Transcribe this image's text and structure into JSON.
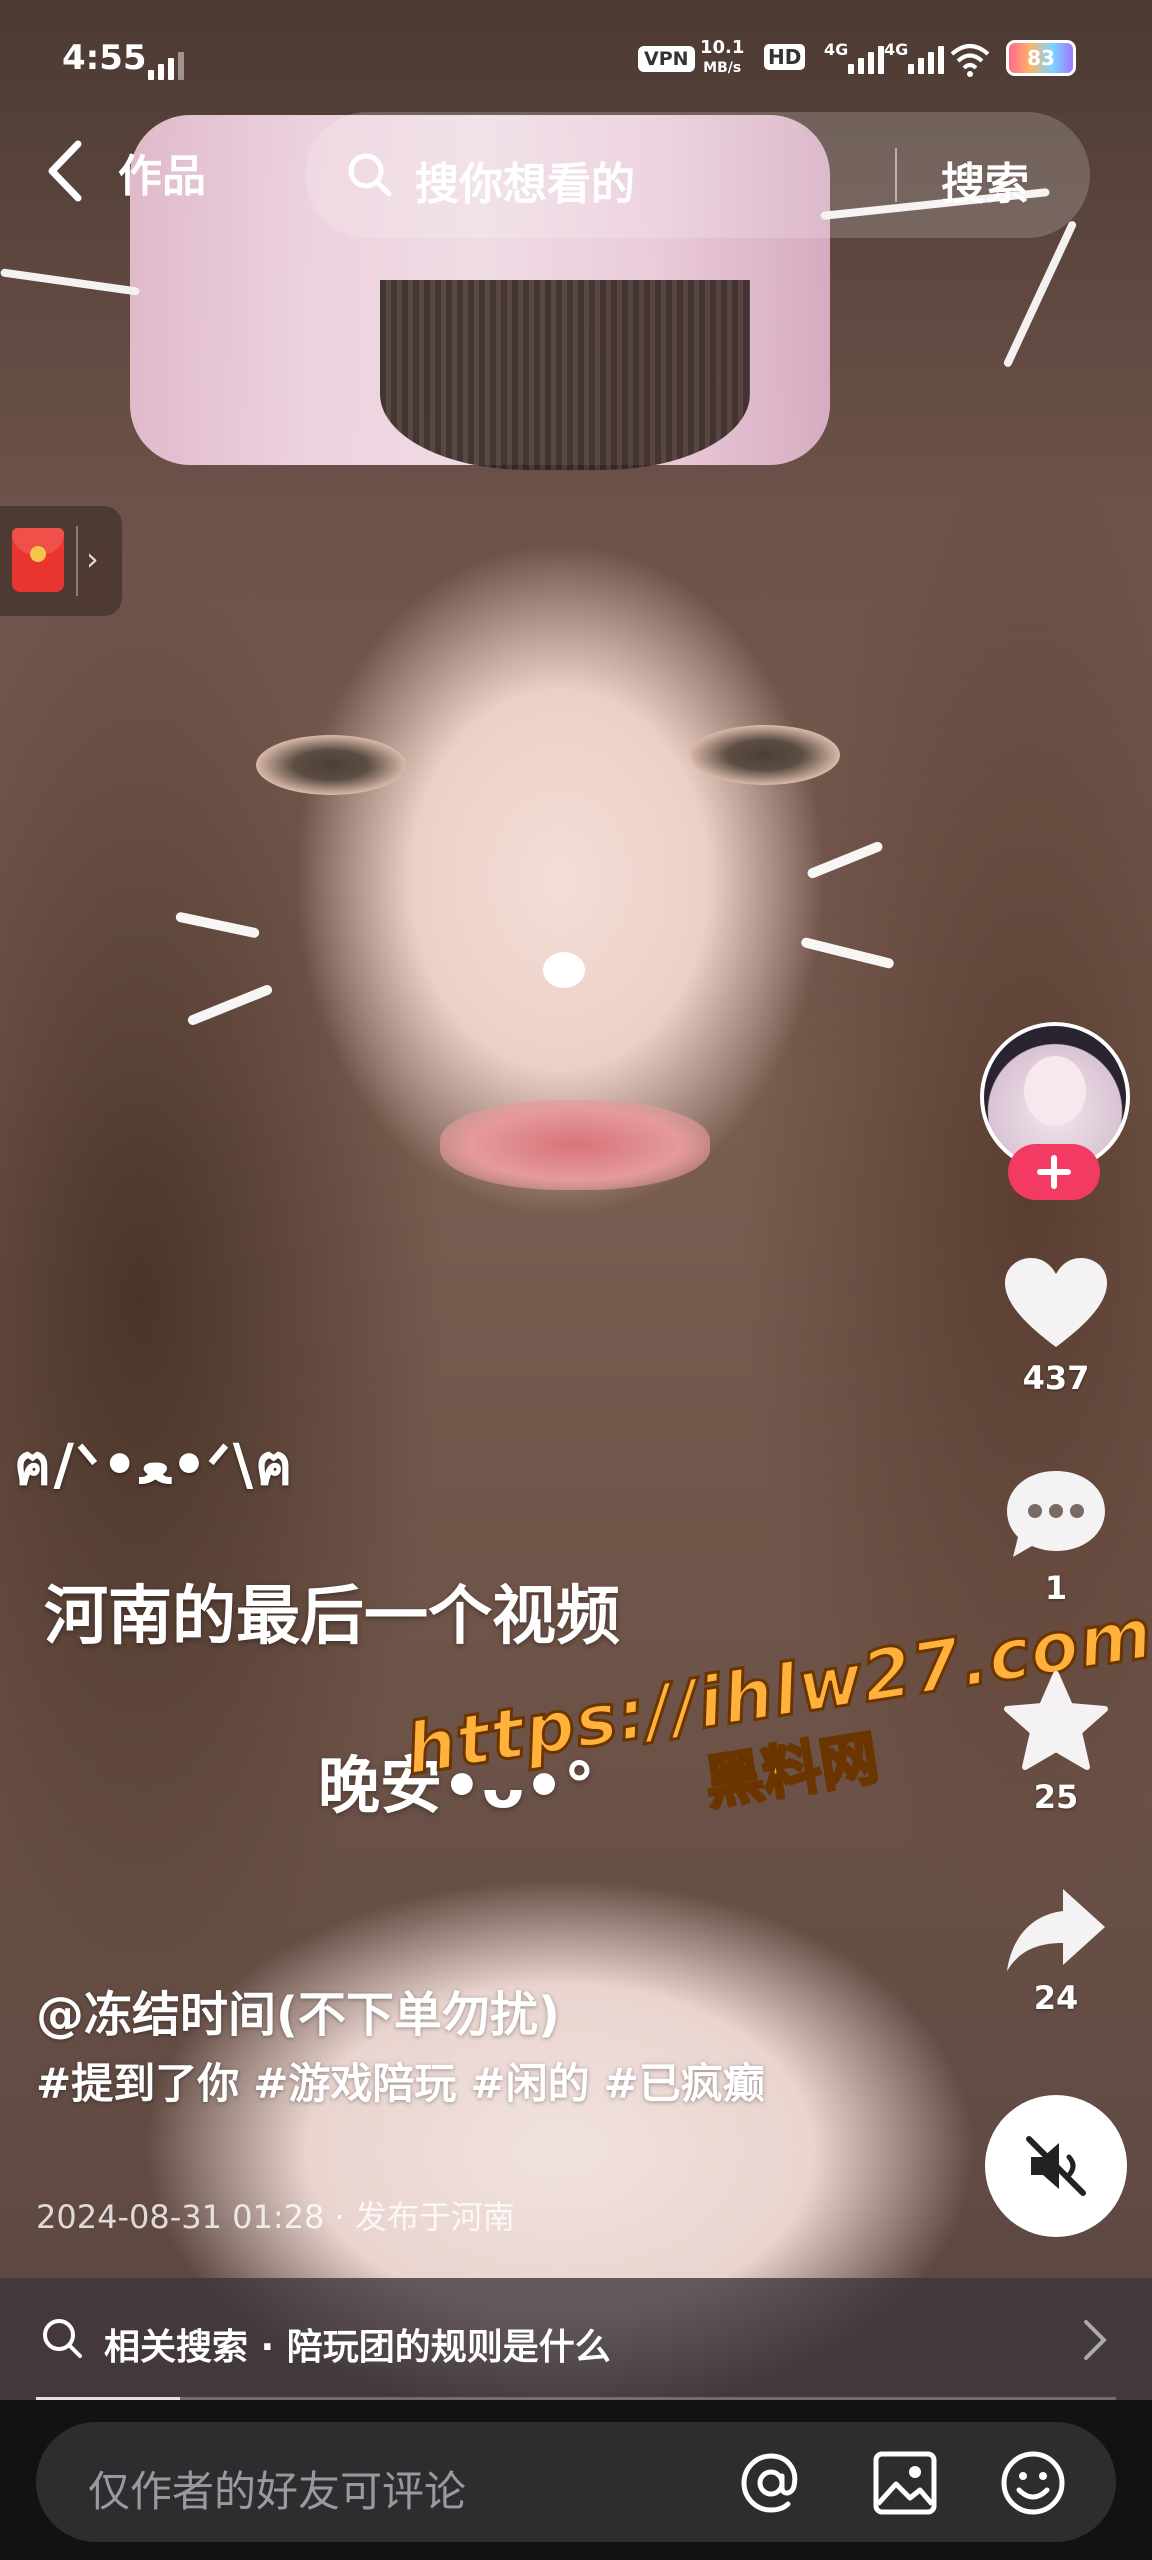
{
  "status_bar": {
    "time": "4:55",
    "vpn": "VPN",
    "speed_value": "10.1",
    "speed_unit": "MB/s",
    "hd": "HD",
    "net1": "4G",
    "net2": "4G",
    "battery": "83"
  },
  "nav": {
    "back_label": "作品",
    "search_placeholder": "搜你想看的",
    "search_button": "搜索"
  },
  "video": {
    "kaomoji": "ฅ/ᐠ•ﻌ•ᐟ\\ฅ",
    "caption_main": "河南的最后一个视频",
    "caption_goodnight": "晚安•ᴗ•°",
    "watermark_url": "https://ihlw27.com",
    "watermark_name": "黑料网"
  },
  "actions": {
    "likes": "437",
    "comments": "1",
    "favorites": "25",
    "shares": "24"
  },
  "post": {
    "author": "@冻结时间(不下单勿扰)",
    "tags": [
      "#提到了你",
      "#游戏陪玩",
      "#闲的",
      "#已疯癫"
    ],
    "date": "2024-08-31 01:28 · 发布于河南"
  },
  "related": {
    "text": "相关搜索 · 陪玩团的规则是什么"
  },
  "comment_bar": {
    "placeholder": "仅作者的好友可评论"
  },
  "icons": {
    "back": "chevron-left-icon",
    "search": "search-icon",
    "red_packet": "red-envelope-icon",
    "like": "heart-icon",
    "comment": "comment-bubble-icon",
    "favorite": "star-icon",
    "share": "share-arrow-icon",
    "mute": "speaker-muted-icon",
    "mention": "at-sign-icon",
    "image": "image-icon",
    "emoji": "smiley-icon"
  },
  "colors": {
    "follow_button": "#f23a62",
    "watermark": "#ffb13c",
    "comment_bar_bg": "#2d2d30"
  }
}
